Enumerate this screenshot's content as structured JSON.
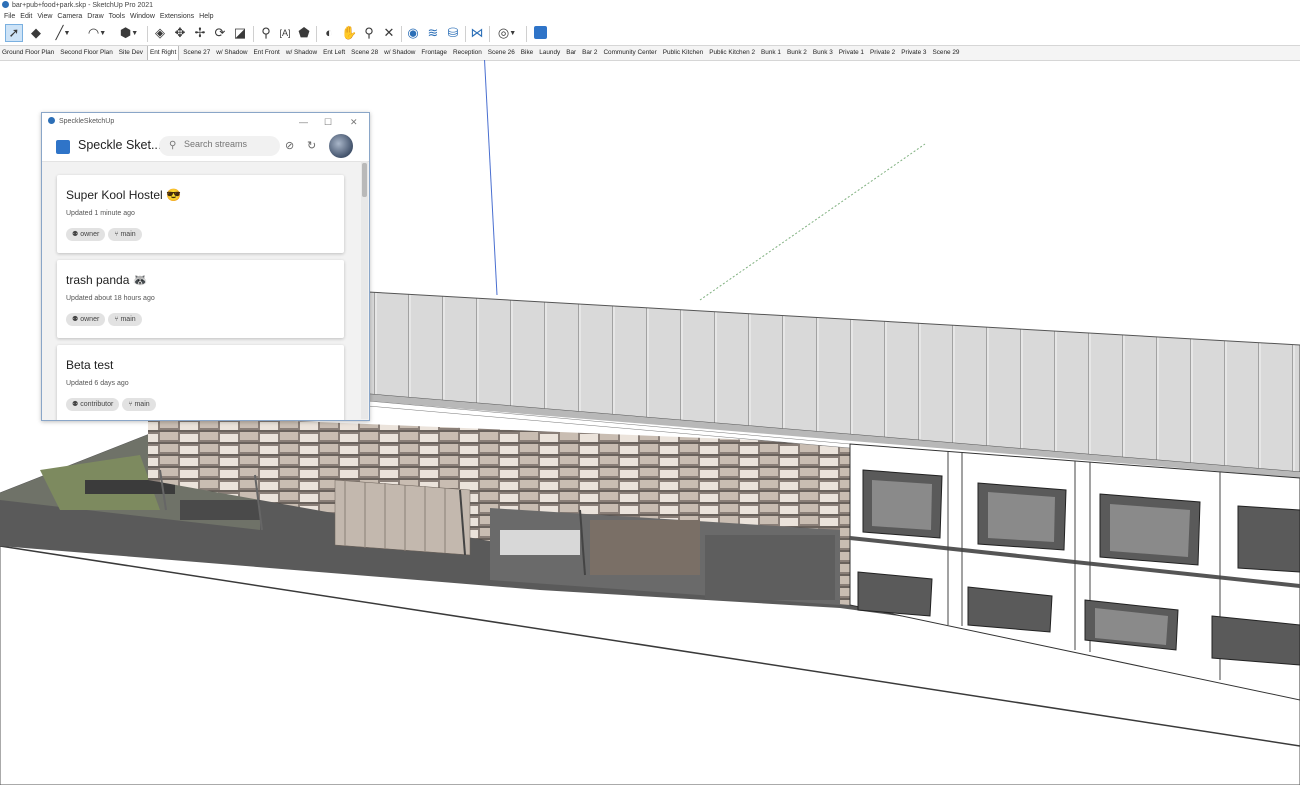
{
  "window_title": "bar+pub+food+park.skp - SketchUp Pro 2021",
  "menu": [
    "File",
    "Edit",
    "View",
    "Camera",
    "Draw",
    "Tools",
    "Window",
    "Extensions",
    "Help"
  ],
  "toolbar_icons": [
    "select-icon",
    "eraser-icon",
    "line-icon",
    "arc-icon",
    "shape-icon",
    "push-pull-icon",
    "move-icon",
    "rotate-icon",
    "scale-icon",
    "offset-icon",
    "tape-measure-icon",
    "text-icon",
    "paint-bucket-icon",
    "orbit-icon",
    "pan-icon",
    "zoom-icon",
    "zoom-extents-icon",
    "warehouse-icon",
    "extension-icon",
    "speckle-icon"
  ],
  "scene_tabs": [
    "Ground Floor Plan",
    "Second Floor Plan",
    "Site Dev",
    "Ent Right",
    "Scene 27",
    "w/ Shadow",
    "Ent Front",
    "w/ Shadow",
    "Ent Left",
    "Scene 28",
    "w/ Shadow",
    "Frontage",
    "Reception",
    "Scene 26",
    "Bike",
    "Laundy",
    "Bar",
    "Bar 2",
    "Community Center",
    "Public Kitchen",
    "Public Kitchen 2",
    "Bunk 1",
    "Bunk 2",
    "Bunk 3",
    "Private 1",
    "Private 2",
    "Private 3",
    "Scene 29"
  ],
  "active_scene": "Ent Right",
  "speckle": {
    "window_title": "SpeckleSketchUp",
    "app_title": "Speckle Sket...",
    "search_placeholder": "Search streams",
    "accent_color": "#2f74c8",
    "streams": [
      {
        "name": "Super Kool Hostel 😎",
        "updated": "Updated 1 minute ago",
        "role": "owner",
        "branch": "main"
      },
      {
        "name": "trash panda 🦝",
        "updated": "Updated about 18 hours ago",
        "role": "owner",
        "branch": "main"
      },
      {
        "name": "Beta test",
        "updated": "Updated 6 days ago",
        "role": "contributor",
        "branch": "main"
      }
    ]
  }
}
